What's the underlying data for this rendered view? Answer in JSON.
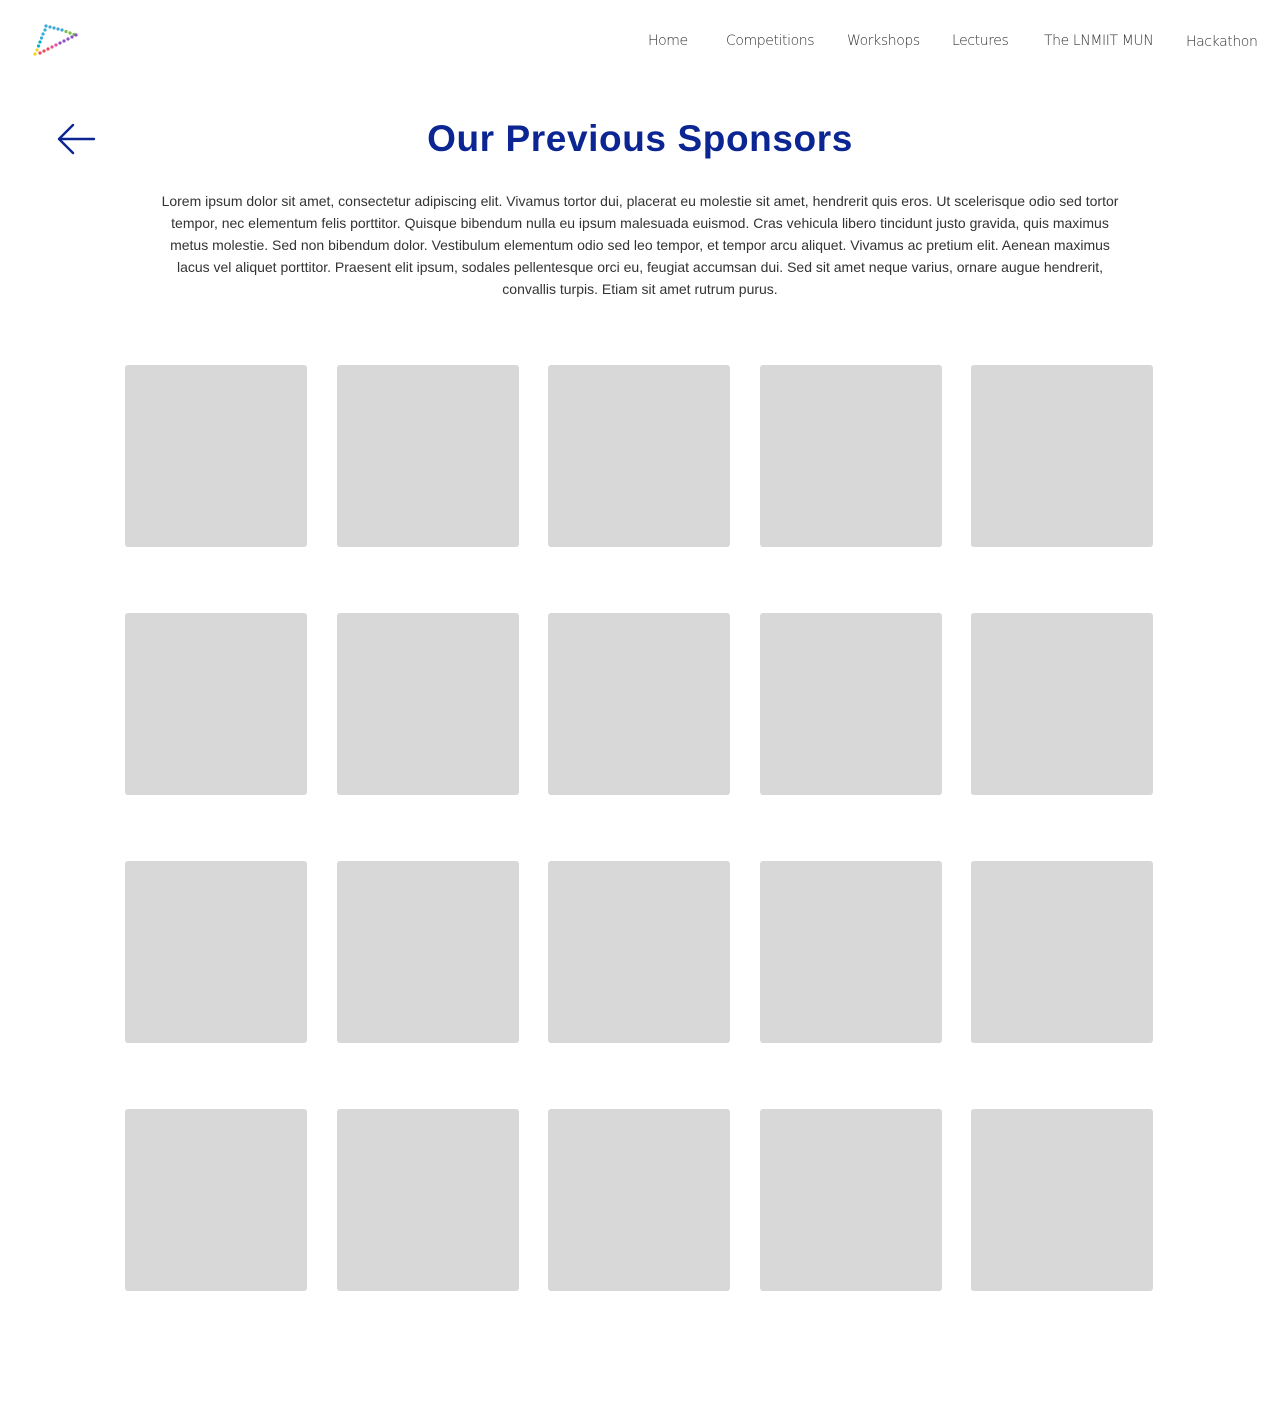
{
  "header": {
    "logo_icon": "triangle-dotted-logo-icon",
    "nav": [
      {
        "label": "Home"
      },
      {
        "label": "Competitions"
      },
      {
        "label": "Workshops"
      },
      {
        "label": "Lectures"
      },
      {
        "label": "The LNMIIT MUN"
      },
      {
        "label": "Hackathon"
      }
    ]
  },
  "back": {
    "icon": "arrow-left-icon"
  },
  "main": {
    "title": "Our Previous Sponsors",
    "description": "Lorem ipsum dolor sit amet, consectetur adipiscing elit. Vivamus tortor dui, placerat eu molestie sit amet, hendrerit quis eros. Ut scelerisque odio sed tortor tempor, nec elementum felis porttitor. Quisque bibendum nulla eu ipsum malesuada euismod. Cras vehicula libero tincidunt justo gravida, quis maximus metus molestie. Sed non bibendum dolor. Vestibulum elementum odio sed leo tempor, et tempor arcu aliquet. Vivamus ac pretium elit. Aenean maximus lacus vel aliquet porttitor. Praesent elit ipsum, sodales pellentesque orci eu, feugiat accumsan dui. Sed sit amet neque varius, ornare augue hendrerit, convallis turpis. Etiam sit amet rutrum purus.",
    "sponsor_tiles": [
      1,
      2,
      3,
      4,
      5,
      6,
      7,
      8,
      9,
      10,
      11,
      12,
      13,
      14,
      15,
      16,
      17,
      18,
      19,
      20
    ]
  },
  "colors": {
    "title": "#0b2592",
    "text": "#333333",
    "tile": "#d8d8d8",
    "background": "#ffffff"
  }
}
